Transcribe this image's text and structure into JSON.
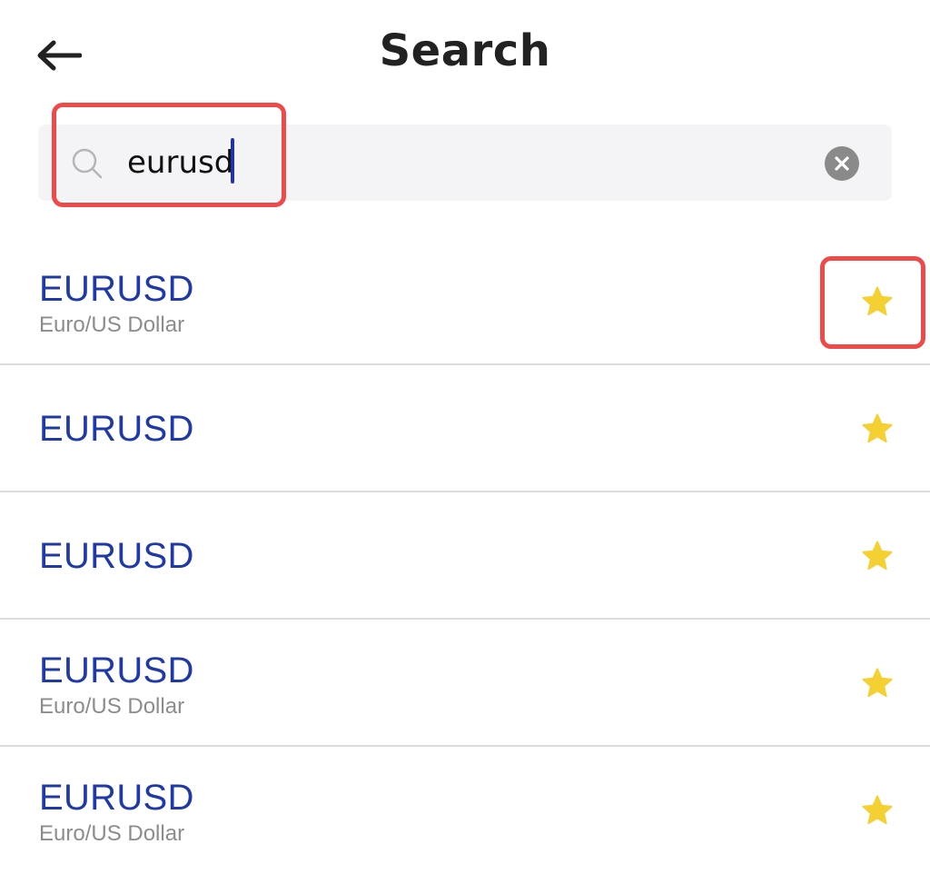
{
  "header": {
    "title": "Search",
    "back_icon": "arrow-left-icon"
  },
  "search": {
    "value": "eurusd",
    "placeholder": "",
    "search_icon": "magnifier-icon",
    "clear_icon": "close-circle-icon"
  },
  "results": [
    {
      "symbol": "EURUSD",
      "description": "Euro/US Dollar",
      "favorite": true
    },
    {
      "symbol": "EURUSD",
      "description": "",
      "favorite": true
    },
    {
      "symbol": "EURUSD",
      "description": "",
      "favorite": true
    },
    {
      "symbol": "EURUSD",
      "description": "Euro/US Dollar",
      "favorite": true
    },
    {
      "symbol": "EURUSD",
      "description": "Euro/US Dollar",
      "favorite": true
    }
  ],
  "colors": {
    "symbol": "#1f3aa8",
    "star": "#f5d032",
    "highlight": "#ee4a4a"
  }
}
